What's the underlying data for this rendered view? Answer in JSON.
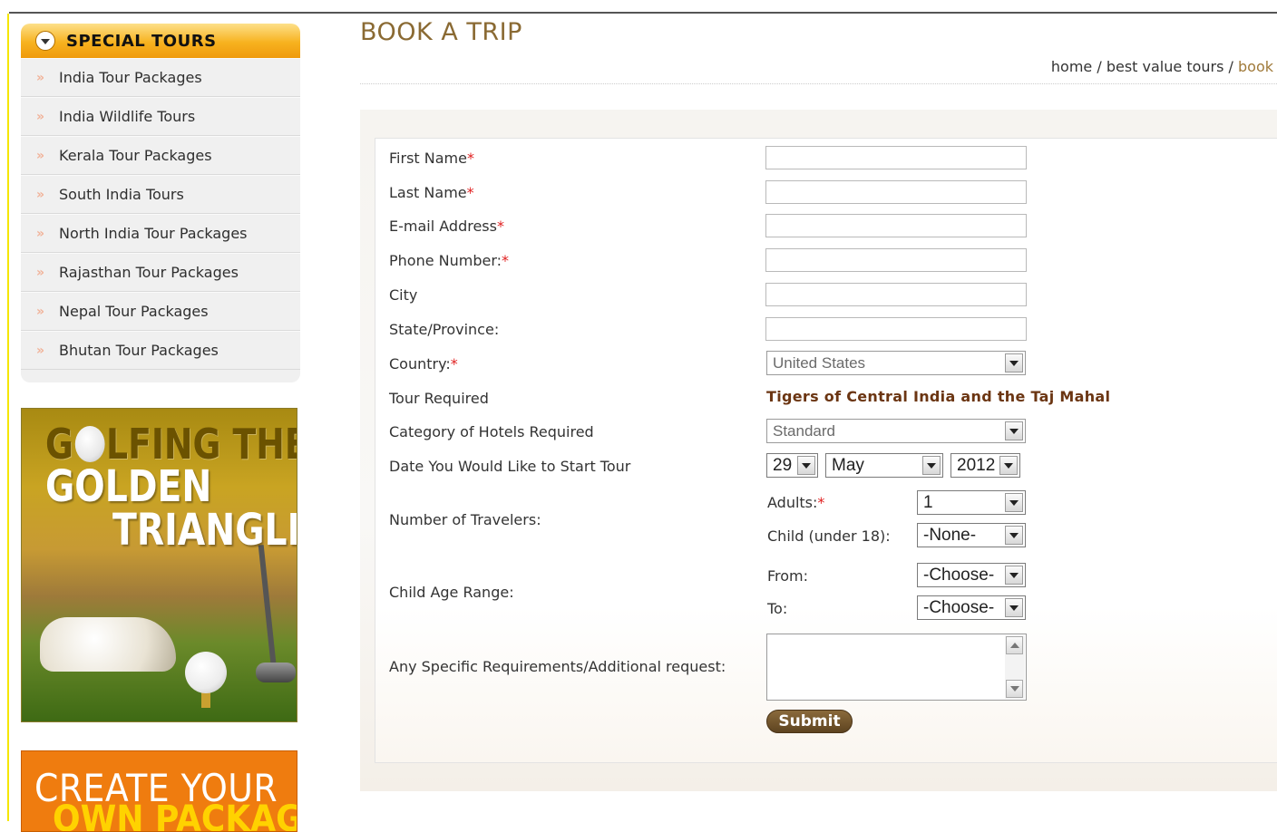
{
  "sidebar": {
    "title": "SPECIAL TOURS",
    "items": [
      "India Tour Packages",
      "India Wildlife Tours",
      "Kerala Tour Packages",
      "South India Tours",
      "North India Tour Packages",
      "Rajasthan Tour Packages",
      "Nepal Tour Packages",
      "Bhutan Tour Packages"
    ],
    "golf_banner": {
      "line1_a": "G",
      "line1_b": "LFING THE",
      "line2": "GOLDEN",
      "line3": "TRIANGLE"
    },
    "create_banner": {
      "line1": "CREATE YOUR",
      "line2": "OWN PACKAGE"
    }
  },
  "page": {
    "title": "BOOK A TRIP",
    "breadcrumb": {
      "home": "home",
      "sep": " / ",
      "section": "best value tours",
      "current": "book"
    }
  },
  "form": {
    "first_name": {
      "label": "First Name",
      "value": ""
    },
    "last_name": {
      "label": "Last Name",
      "value": ""
    },
    "email": {
      "label": "E-mail Address",
      "value": ""
    },
    "phone": {
      "label": "Phone Number:",
      "value": ""
    },
    "city": {
      "label": "City",
      "value": ""
    },
    "state": {
      "label": "State/Province:",
      "value": ""
    },
    "country": {
      "label": "Country:",
      "value": "United States"
    },
    "tour": {
      "label": "Tour Required",
      "value": "Tigers of Central India and the Taj Mahal"
    },
    "hotel_category": {
      "label": "Category of Hotels Required",
      "value": "Standard"
    },
    "start_date": {
      "label": "Date You Would Like to Start Tour",
      "day": "29",
      "month": "May",
      "year": "2012"
    },
    "travelers": {
      "label": "Number of Travelers:",
      "adults_label": "Adults:",
      "adults": "1",
      "child_label": "Child (under 18):",
      "child": "-None-"
    },
    "child_age": {
      "label": "Child Age Range:",
      "from_label": "From:",
      "from": "-Choose-",
      "to_label": "To:",
      "to": "-Choose-"
    },
    "requests": {
      "label": "Any Specific Requirements/Additional request:",
      "value": ""
    },
    "required_mark": "*",
    "submit_label": "Submit"
  }
}
